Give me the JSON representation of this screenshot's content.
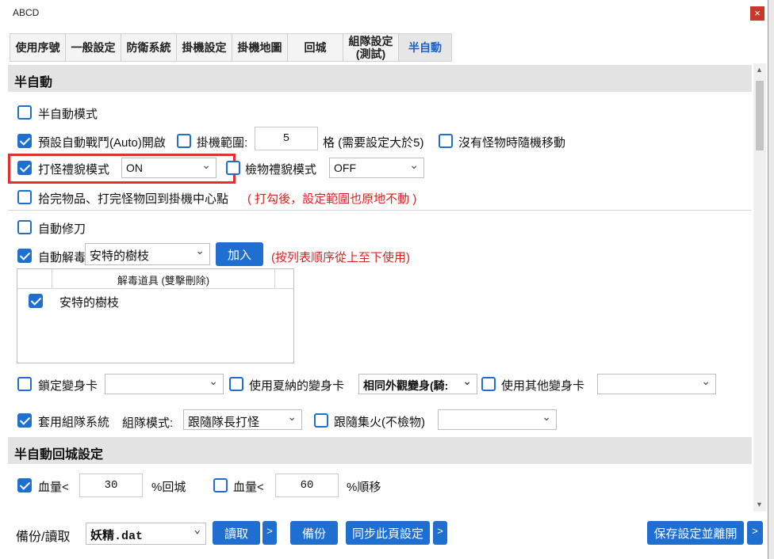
{
  "window": {
    "title": "ABCD",
    "close_icon": "×"
  },
  "tabs": [
    {
      "label": "使用序號"
    },
    {
      "label": "一般設定"
    },
    {
      "label": "防衛系統"
    },
    {
      "label": "掛機設定"
    },
    {
      "label": "掛機地圖"
    },
    {
      "label": "回城"
    },
    {
      "label": "組隊設定\n(測試)"
    },
    {
      "label": "半自動"
    }
  ],
  "semi_auto": {
    "header": "半自動",
    "mode_label": "半自動模式",
    "auto_battle_label": "預設自動戰鬥(Auto)開啟",
    "range_label": "掛機範圍:",
    "range_value": "5",
    "range_hint": "格 (需要設定大於5)",
    "random_move_label": "沒有怪物時隨機移動",
    "fight_polite_label": "打怪禮貌模式",
    "fight_polite_value": "ON",
    "pickup_polite_label": "檢物禮貌模式",
    "pickup_polite_value": "OFF",
    "return_center_label": "拾完物品、打完怪物回到掛機中心點",
    "return_center_hint": "( 打勾後，設定範圍也原地不動 )",
    "auto_repair_label": "自動修刀",
    "auto_detox_label": "自動解毒",
    "detox_select_value": "安特的樹枝",
    "add_button": "加入",
    "detox_hint": "(按列表順序從上至下使用)",
    "detox_table_header": "解毒道具 (雙擊刪除)",
    "detox_items": [
      {
        "label": "安特的樹枝",
        "checked": true
      }
    ],
    "lock_card_label": "鎖定變身卡",
    "lock_card_value": "",
    "summer_card_label": "使用夏納的變身卡",
    "summer_card_value": "相同外觀變身(騎:",
    "other_card_label": "使用其他變身卡",
    "other_card_value": "",
    "party_label": "套用組隊系統",
    "party_mode_label": "組隊模式:",
    "party_mode_value": "跟隨隊長打怪",
    "follow_fire_label": "跟隨集火(不檢物)",
    "follow_fire_value": ""
  },
  "return_settings": {
    "header": "半自動回城設定",
    "hp_label": "血量<",
    "hp_return_value": "30",
    "hp_return_suffix": "%回城",
    "hp_move_value": "60",
    "hp_move_suffix": "%順移"
  },
  "footer": {
    "backup_label": "備份/讀取",
    "file_value": "妖精.dat",
    "read_button": "讀取",
    "more": ">",
    "backup_button": "備份",
    "sync_button": "同步此頁設定",
    "save_button": "保存設定並離開"
  },
  "colors": {
    "accent": "#1f6fd1",
    "highlight_border": "#e03030",
    "hint_red": "#e02020"
  }
}
